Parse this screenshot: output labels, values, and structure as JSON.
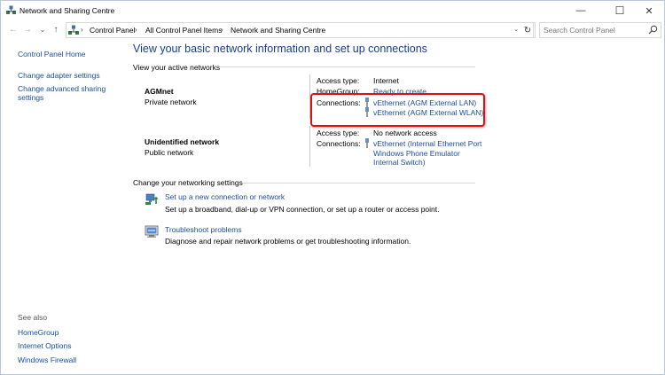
{
  "window": {
    "title": "Network and Sharing Centre",
    "controls": {
      "minimize": "—",
      "maximize": "☐",
      "close": "✕"
    }
  },
  "address": {
    "back": "←",
    "forward": "→",
    "recent": "⌄",
    "up": "↑",
    "crumbs": [
      "Control Panel",
      "All Control Panel Items",
      "Network and Sharing Centre"
    ],
    "separator": "›",
    "dropdown": "⌄",
    "refresh": "↻",
    "search_placeholder": "Search Control Panel"
  },
  "sidebar": {
    "home": "Control Panel Home",
    "links": [
      "Change adapter settings",
      "Change advanced sharing",
      "settings"
    ],
    "see_also_label": "See also",
    "see_also": [
      "HomeGroup",
      "Internet Options",
      "Windows Firewall"
    ]
  },
  "main": {
    "heading": "View your basic network information and set up connections",
    "active_label": "View your active networks",
    "networks": [
      {
        "name": "AGMnet",
        "category": "Private network",
        "access_label": "Access type:",
        "access_value": "Internet",
        "homegroup_label": "HomeGroup:",
        "homegroup_value": "Ready to create",
        "connections_label": "Connections:",
        "connections": [
          "vEthernet (AGM External LAN)",
          "vEthernet (AGM External WLAN)"
        ]
      },
      {
        "name": "Unidentified network",
        "category": "Public network",
        "access_label": "Access type:",
        "access_value": "No network access",
        "connections_label": "Connections:",
        "connection_lines": [
          "vEthernet (Internal Ethernet Port",
          "Windows Phone Emulator",
          "Internal Switch)"
        ]
      }
    ],
    "change_label": "Change your networking settings",
    "tasks": [
      {
        "link": "Set up a new connection or network",
        "desc": "Set up a broadband, dial-up or VPN connection, or set up a router or access point.",
        "icon": "new-connection-icon"
      },
      {
        "link": "Troubleshoot problems",
        "desc": "Diagnose and repair network problems or get troubleshooting information.",
        "icon": "troubleshoot-icon"
      }
    ]
  },
  "colors": {
    "link": "#1a4c9e",
    "heading": "#1a3d8f",
    "highlight": "#e01010"
  }
}
